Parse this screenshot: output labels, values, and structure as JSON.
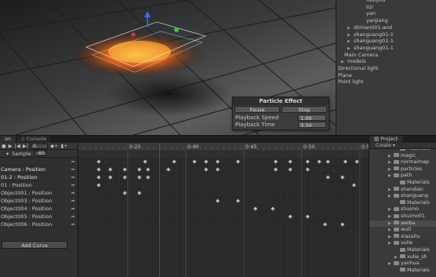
{
  "scene": {
    "particle_effect": {
      "title": "Particle Effect",
      "pause_label": "Pause",
      "stop_label": "Stop",
      "speed_label": "Playback Speed",
      "speed_value": "1.00",
      "time_label": "Playback Time",
      "time_value": "3.34"
    }
  },
  "hierarchy": {
    "items": [
      {
        "label": "fudiyou",
        "tri": false
      },
      {
        "label": "lizi",
        "tri": false
      },
      {
        "label": "yan",
        "tri": false
      },
      {
        "label": "yanjiang",
        "tri": false
      },
      {
        "label": "dimian001-and",
        "tri": true
      },
      {
        "label": "shanguang01-1",
        "tri": true
      },
      {
        "label": "shanguang01-1",
        "tri": true
      },
      {
        "label": "shanguang01-1",
        "tri": true
      },
      {
        "label": "Main Camera",
        "tri": false
      },
      {
        "label": "models",
        "tri": true
      },
      {
        "label": "Directional light",
        "tri": false
      },
      {
        "label": "Plane",
        "tri": false
      },
      {
        "label": "Point light",
        "tri": false
      }
    ]
  },
  "animation": {
    "tab_animation": "on",
    "tab_console": "Console",
    "frame_value": "0",
    "sample_label": "Sample",
    "sample_value": "60",
    "ruler_labels": [
      "0:25",
      "0:40",
      "0:45",
      "0:50",
      "0:55"
    ],
    "curves": [
      {
        "label": "",
        "selected": false
      },
      {
        "label": "Camera : Position",
        "selected": true
      },
      {
        "label": "01-2 : Position",
        "selected": true
      },
      {
        "label": "01 : Position",
        "selected": false
      },
      {
        "label": "Object001 : Position",
        "selected": false
      },
      {
        "label": "Object003 : Position",
        "selected": false
      },
      {
        "label": "Object004 : Position",
        "selected": false
      },
      {
        "label": "Object005 : Position",
        "selected": false
      },
      {
        "label": "Object006 : Position",
        "selected": false
      }
    ],
    "add_curve_label": "Add Curve",
    "keyframes": [
      [
        0.07,
        0.23,
        0.33,
        0.4,
        0.44,
        0.48,
        0.55,
        0.68,
        0.73,
        0.79,
        0.83,
        0.86,
        0.92,
        0.96
      ],
      [
        0.07,
        0.11,
        0.16,
        0.21,
        0.24,
        0.31,
        0.44,
        0.48,
        0.68,
        0.73,
        0.79
      ],
      [
        0.07,
        0.11,
        0.16,
        0.21,
        0.24,
        0.86,
        0.91
      ],
      [
        0.07,
        0.95
      ],
      [
        0.16,
        0.21
      ],
      [
        0.48,
        0.55
      ],
      [
        0.61,
        0.67
      ],
      [
        0.73,
        0.79
      ],
      [
        0.85,
        0.91
      ]
    ]
  },
  "project": {
    "tab": "Project",
    "create_label": "Create",
    "items": [
      {
        "label": "Materials",
        "indent": 2,
        "tri": false,
        "selected": false
      },
      {
        "label": "magic",
        "indent": 1,
        "tri": true,
        "selected": false
      },
      {
        "label": "normalmap",
        "indent": 1,
        "tri": true,
        "selected": false
      },
      {
        "label": "particles",
        "indent": 1,
        "tri": true,
        "selected": false
      },
      {
        "label": "path",
        "indent": 1,
        "tri": true,
        "selected": false
      },
      {
        "label": "Materials",
        "indent": 2,
        "tri": false,
        "selected": false
      },
      {
        "label": "shandian",
        "indent": 1,
        "tri": true,
        "selected": false
      },
      {
        "label": "shanguang",
        "indent": 1,
        "tri": true,
        "selected": false
      },
      {
        "label": "Materials",
        "indent": 2,
        "tri": false,
        "selected": false
      },
      {
        "label": "shuimo",
        "indent": 1,
        "tri": true,
        "selected": false
      },
      {
        "label": "shuimo01",
        "indent": 1,
        "tri": true,
        "selected": false
      },
      {
        "label": "weiba",
        "indent": 1,
        "tri": true,
        "selected": true
      },
      {
        "label": "wuti",
        "indent": 1,
        "tri": true,
        "selected": false
      },
      {
        "label": "xiazaitu",
        "indent": 1,
        "tri": true,
        "selected": false
      },
      {
        "label": "xulie",
        "indent": 1,
        "tri": true,
        "selected": false
      },
      {
        "label": "Materials",
        "indent": 2,
        "tri": false,
        "selected": false
      },
      {
        "label": "xulie_sh",
        "indent": 2,
        "tri": true,
        "selected": false
      },
      {
        "label": "yanhua",
        "indent": 1,
        "tri": true,
        "selected": false
      },
      {
        "label": "Materials",
        "indent": 2,
        "tri": false,
        "selected": false
      }
    ]
  }
}
